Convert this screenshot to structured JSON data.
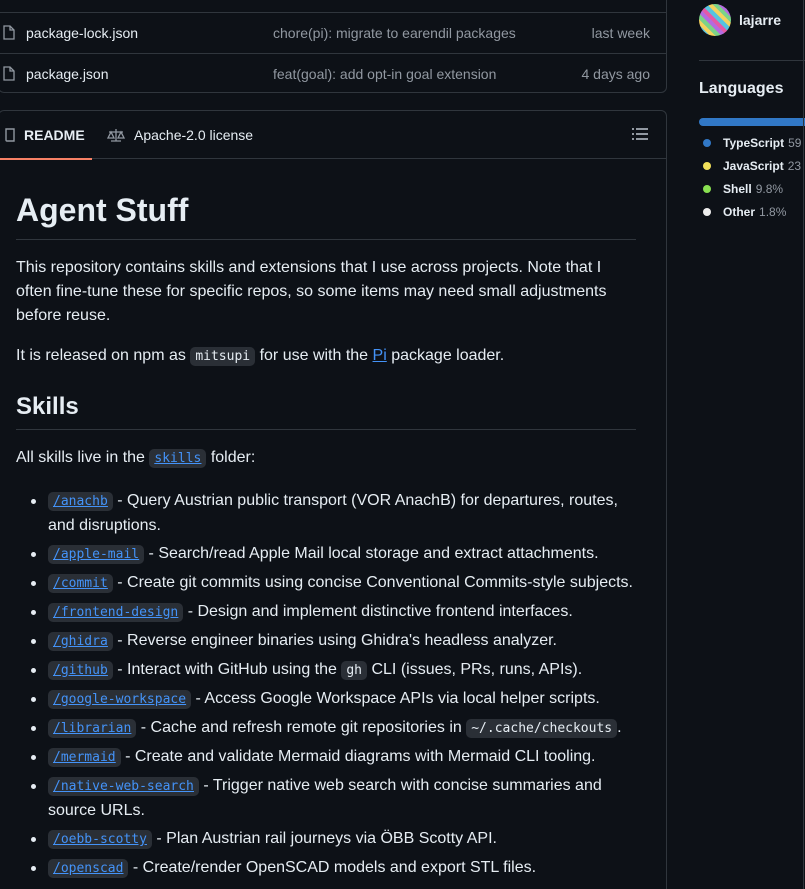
{
  "files": [
    {
      "name": "package-lock.json",
      "message": "chore(pi): migrate to earendil packages",
      "date": "last week"
    },
    {
      "name": "package.json",
      "message": "feat(goal): add opt-in goal extension",
      "date": "4 days ago"
    }
  ],
  "tabs": {
    "readme": "README",
    "license": "Apache-2.0 license"
  },
  "readme": {
    "title": "Agent Stuff",
    "intro": "This repository contains skills and extensions that I use across projects. Note that I often fine-tune these for specific repos, so some items may need small adjustments before reuse.",
    "npm_pre": "It is released on npm as",
    "npm_code": "mitsupi",
    "npm_mid": "for use with the",
    "npm_link": "Pi",
    "npm_post": "package loader.",
    "skills_heading": "Skills",
    "skills_pre": "All skills live in the",
    "skills_code": "skills",
    "skills_post": "folder:",
    "skills": [
      {
        "cmd": "/anachb",
        "desc": "- Query Austrian public transport (VOR AnachB) for departures, routes, and disruptions."
      },
      {
        "cmd": "/apple-mail",
        "desc": "- Search/read Apple Mail local storage and extract attachments."
      },
      {
        "cmd": "/commit",
        "desc": "- Create git commits using concise Conventional Commits-style subjects."
      },
      {
        "cmd": "/frontend-design",
        "desc": "- Design and implement distinctive frontend interfaces."
      },
      {
        "cmd": "/ghidra",
        "desc": "- Reverse engineer binaries using Ghidra's headless analyzer."
      },
      {
        "cmd": "/github",
        "desc": "- Interact with GitHub using the",
        "code": "gh",
        "after": "CLI (issues, PRs, runs, APIs)."
      },
      {
        "cmd": "/google-workspace",
        "desc": "- Access Google Workspace APIs via local helper scripts."
      },
      {
        "cmd": "/librarian",
        "desc": "- Cache and refresh remote git repositories in",
        "code": "~/.cache/checkouts",
        "after": "."
      },
      {
        "cmd": "/mermaid",
        "desc": "- Create and validate Mermaid diagrams with Mermaid CLI tooling."
      },
      {
        "cmd": "/native-web-search",
        "desc": "- Trigger native web search with concise summaries and source URLs."
      },
      {
        "cmd": "/oebb-scotty",
        "desc": "- Plan Austrian rail journeys via ÖBB Scotty API."
      },
      {
        "cmd": "/openscad",
        "desc": "- Create/render OpenSCAD models and export STL files."
      }
    ]
  },
  "sidebar": {
    "author": "lajarre",
    "languages_title": "Languages",
    "languages": [
      {
        "name": "TypeScript",
        "pct": "59",
        "color": "#3178c6"
      },
      {
        "name": "JavaScript",
        "pct": "23",
        "color": "#f1e05a"
      },
      {
        "name": "Shell",
        "pct": "9.8%",
        "color": "#89e051"
      },
      {
        "name": "Other",
        "pct": "1.8%",
        "color": "#ededed"
      }
    ]
  }
}
